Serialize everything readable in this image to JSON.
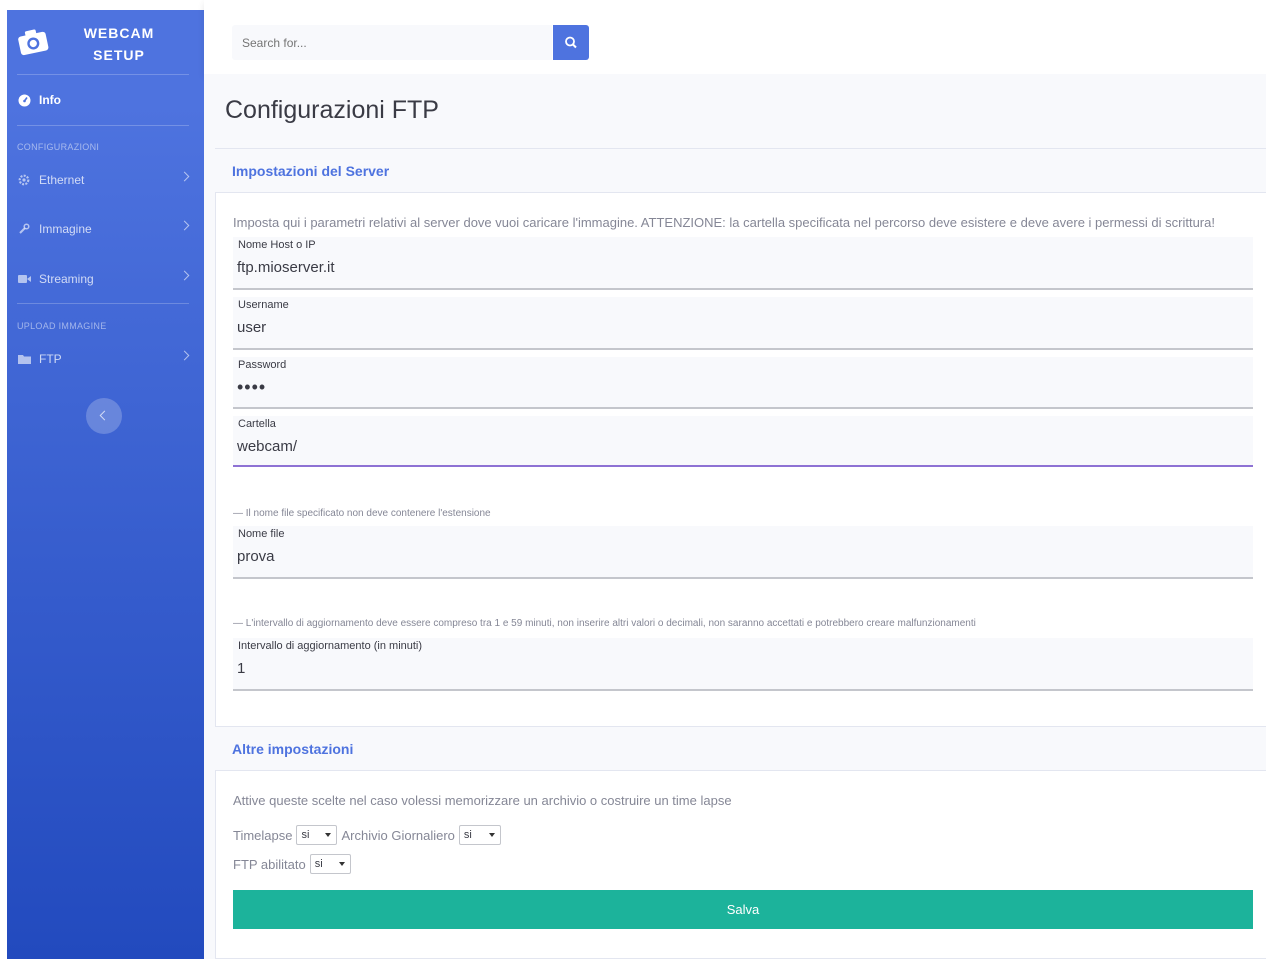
{
  "sidebar": {
    "brand": "WEBCAM\nSETUP",
    "items": [
      {
        "label": "Info"
      },
      {
        "label": "Ethernet"
      },
      {
        "label": "Immagine"
      },
      {
        "label": "Streaming"
      },
      {
        "label": "FTP"
      }
    ],
    "headings": [
      "CONFIGURAZIONI",
      "UPLOAD IMMAGINE"
    ]
  },
  "search": {
    "placeholder": "Search for..."
  },
  "page": {
    "title": "Configurazioni FTP"
  },
  "server_card": {
    "header": "Impostazioni del Server",
    "intro": "Imposta qui i parametri relativi al server dove vuoi caricare l'immagine. ATTENZIONE: la cartella specificata nel percorso deve esistere e deve avere i permessi di scrittura!",
    "fields": {
      "host": {
        "label": "Nome Host o IP",
        "value": "ftp.mioserver.it"
      },
      "username": {
        "label": "Username",
        "value": "user"
      },
      "password": {
        "label": "Password",
        "value": "••••"
      },
      "folder": {
        "label": "Cartella",
        "value": "webcam/"
      },
      "filename": {
        "label": "Nome file",
        "value": "prova"
      },
      "interval": {
        "label": "Intervallo di aggiornamento (in minuti)",
        "value": "1"
      }
    },
    "filename_help": "— Il nome file specificato non deve contenere l'estensione",
    "interval_help": "— L'intervallo di aggiornamento deve essere compreso tra 1 e 59 minuti, non inserire altri valori o decimali, non saranno accettati e potrebbero creare malfunzionamenti"
  },
  "other_card": {
    "header": "Altre impostazioni",
    "text": "Attive queste scelte nel caso volessi memorizzare un archivio o costruire un time lapse",
    "options": {
      "timelapse": {
        "label": "Timelapse",
        "value": "si"
      },
      "archive": {
        "label": "Archivio Giornaliero",
        "value": "si"
      },
      "ftp_enabled": {
        "label": "FTP abilitato",
        "value": "si"
      }
    },
    "save_label": "Salva"
  },
  "colors": {
    "primary": "#4e73df",
    "save": "#1cb39b",
    "active_underline": "#8e72d4"
  },
  "icons": [
    "camera-icon",
    "dashboard-icon",
    "cog-icon",
    "wrench-icon",
    "video-icon",
    "folder-icon",
    "search-icon",
    "chevron-right-icon",
    "chevron-left-icon"
  ]
}
